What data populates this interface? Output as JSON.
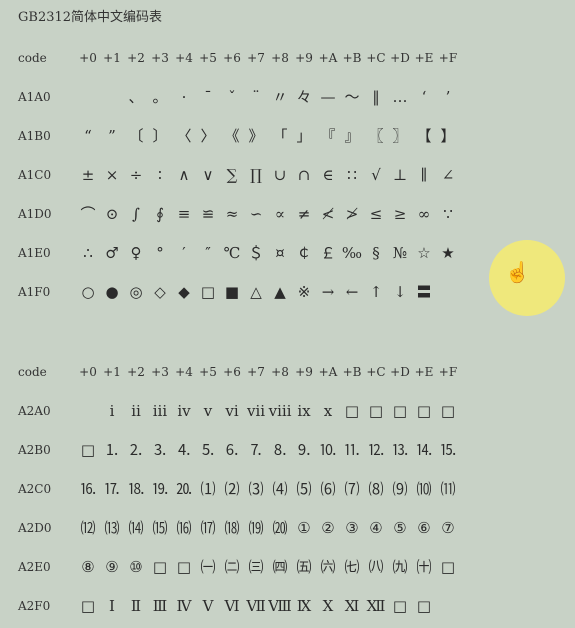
{
  "title": "GB2312简体中文编码表",
  "table1": {
    "header": [
      "code",
      "+0",
      "+1",
      "+2",
      "+3",
      "+4",
      "+5",
      "+6",
      "+7",
      "+8",
      "+9",
      "+A",
      "+B",
      "+C",
      "+D",
      "+E",
      "+F"
    ],
    "rows": [
      {
        "code": "A1A0",
        "cells": [
          "",
          "",
          "、",
          "。",
          "·",
          "ˉ",
          "ˇ",
          "¨",
          "〃",
          "々",
          "—",
          "～",
          "‖",
          "…",
          "‘",
          "’"
        ]
      },
      {
        "code": "A1B0",
        "cells": [
          "“",
          "”",
          "〔",
          "〕",
          "〈",
          "〉",
          "《",
          "》",
          "「",
          "」",
          "『",
          "』",
          "〖",
          "〗",
          "【",
          "】"
        ]
      },
      {
        "code": "A1C0",
        "cells": [
          "±",
          "×",
          "÷",
          "∶",
          "∧",
          "∨",
          "∑",
          "∏",
          "∪",
          "∩",
          "∈",
          "∷",
          "√",
          "⊥",
          "∥",
          "∠"
        ]
      },
      {
        "code": "A1D0",
        "cells": [
          "⌒",
          "⊙",
          "∫",
          "∮",
          "≡",
          "≌",
          "≈",
          "∽",
          "∝",
          "≠",
          "≮",
          "≯",
          "≤",
          "≥",
          "∞",
          "∵"
        ]
      },
      {
        "code": "A1E0",
        "cells": [
          "∴",
          "♂",
          "♀",
          "°",
          "′",
          "″",
          "℃",
          "＄",
          "¤",
          "￠",
          "￡",
          "‰",
          "§",
          "№",
          "☆",
          "★"
        ]
      },
      {
        "code": "A1F0",
        "cells": [
          "○",
          "●",
          "◎",
          "◇",
          "◆",
          "□",
          "■",
          "△",
          "▲",
          "※",
          "→",
          "←",
          "↑",
          "↓",
          "〓",
          ""
        ]
      }
    ]
  },
  "table2": {
    "header": [
      "code",
      "+0",
      "+1",
      "+2",
      "+3",
      "+4",
      "+5",
      "+6",
      "+7",
      "+8",
      "+9",
      "+A",
      "+B",
      "+C",
      "+D",
      "+E",
      "+F"
    ],
    "rows": [
      {
        "code": "A2A0",
        "cells": [
          "",
          "ⅰ",
          "ⅱ",
          "ⅲ",
          "ⅳ",
          "ⅴ",
          "ⅵ",
          "ⅶ",
          "ⅷ",
          "ⅸ",
          "ⅹ",
          "□",
          "□",
          "□",
          "□",
          "□"
        ]
      },
      {
        "code": "A2B0",
        "cells": [
          "□",
          "⒈",
          "⒉",
          "⒊",
          "⒋",
          "⒌",
          "⒍",
          "⒎",
          "⒏",
          "⒐",
          "⒑",
          "⒒",
          "⒓",
          "⒔",
          "⒕",
          "⒖"
        ]
      },
      {
        "code": "A2C0",
        "cells": [
          "⒗",
          "⒘",
          "⒙",
          "⒚",
          "⒛",
          "⑴",
          "⑵",
          "⑶",
          "⑷",
          "⑸",
          "⑹",
          "⑺",
          "⑻",
          "⑼",
          "⑽",
          "⑾"
        ]
      },
      {
        "code": "A2D0",
        "cells": [
          "⑿",
          "⒀",
          "⒁",
          "⒂",
          "⒃",
          "⒄",
          "⒅",
          "⒆",
          "⒇",
          "①",
          "②",
          "③",
          "④",
          "⑤",
          "⑥",
          "⑦"
        ]
      },
      {
        "code": "A2E0",
        "cells": [
          "⑧",
          "⑨",
          "⑩",
          "□",
          "□",
          "㈠",
          "㈡",
          "㈢",
          "㈣",
          "㈤",
          "㈥",
          "㈦",
          "㈧",
          "㈨",
          "㈩",
          "□"
        ]
      },
      {
        "code": "A2F0",
        "cells": [
          "□",
          "Ⅰ",
          "Ⅱ",
          "Ⅲ",
          "Ⅳ",
          "Ⅴ",
          "Ⅵ",
          "Ⅶ",
          "Ⅷ",
          "Ⅸ",
          "Ⅹ",
          "Ⅺ",
          "Ⅻ",
          "□",
          "□",
          ""
        ]
      }
    ]
  },
  "cursor": {
    "icon": "hand-pointer-icon",
    "highlight_color": "#f6ec6e"
  }
}
